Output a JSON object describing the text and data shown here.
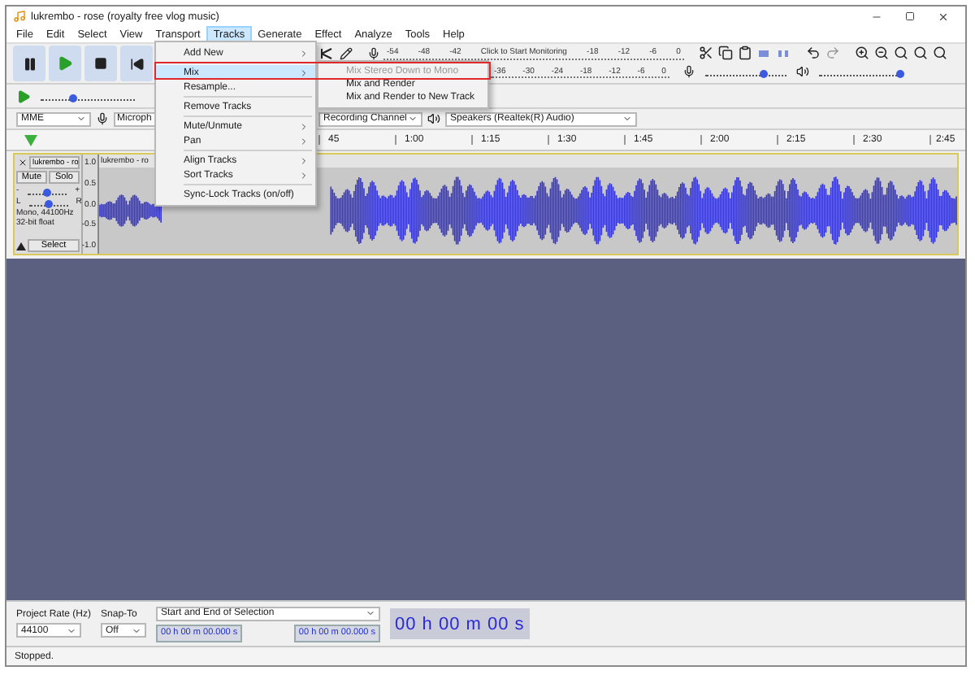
{
  "window": {
    "title": "lukrembo - rose (royalty free vlog music)"
  },
  "menu_bar": [
    {
      "label": "File",
      "selected": false
    },
    {
      "label": "Edit",
      "selected": false
    },
    {
      "label": "Select",
      "selected": false
    },
    {
      "label": "View",
      "selected": false
    },
    {
      "label": "Transport",
      "selected": false
    },
    {
      "label": "Tracks",
      "selected": true
    },
    {
      "label": "Generate",
      "selected": false
    },
    {
      "label": "Effect",
      "selected": false
    },
    {
      "label": "Analyze",
      "selected": false
    },
    {
      "label": "Tools",
      "selected": false
    },
    {
      "label": "Help",
      "selected": false
    }
  ],
  "tracks_menu": {
    "groups": [
      {
        "items": [
          {
            "label": "Add New",
            "submenu": true,
            "selected": false
          }
        ]
      },
      {
        "items": [
          {
            "label": "Mix",
            "submenu": true,
            "selected": true
          },
          {
            "label": "Resample...",
            "submenu": false,
            "selected": false
          }
        ]
      },
      {
        "items": [
          {
            "label": "Remove Tracks",
            "submenu": false,
            "selected": false
          }
        ]
      },
      {
        "items": [
          {
            "label": "Mute/Unmute",
            "submenu": true,
            "selected": false
          },
          {
            "label": "Pan",
            "submenu": true,
            "selected": false
          }
        ]
      },
      {
        "items": [
          {
            "label": "Align Tracks",
            "submenu": true,
            "selected": false
          },
          {
            "label": "Sort Tracks",
            "submenu": true,
            "selected": false
          }
        ]
      },
      {
        "items": [
          {
            "label": "Sync-Lock Tracks (on/off)",
            "submenu": false,
            "selected": false
          }
        ]
      }
    ]
  },
  "mix_submenu": [
    {
      "label": "Mix Stereo Down to Mono",
      "disabled": true
    },
    {
      "label": "Mix and Render",
      "disabled": false
    },
    {
      "label": "Mix and Render to New Track",
      "disabled": false
    }
  ],
  "meters": {
    "record_scale": [
      "-54",
      "-48",
      "-42"
    ],
    "record_prompt": "Click to Start Monitoring",
    "record_scale_end": [
      "-18",
      "-12",
      "-6",
      "0"
    ],
    "playback_scale": [
      "-36",
      "-30",
      "-24",
      "-18",
      "-12",
      "-6",
      "0"
    ]
  },
  "mixer": {
    "recording_volume": {
      "level": 0.72
    },
    "playback_volume": {
      "level": 1.0
    }
  },
  "play_at_speed": {
    "level": 0.35
  },
  "devices": {
    "host": "MME",
    "recording_device": "Microph",
    "recording_channels": "Recording Channel",
    "playback_device": "Speakers (Realtek(R) Audio)"
  },
  "ruler": {
    "labels": [
      "45",
      "1:00",
      "1:15",
      "1:30",
      "1:45",
      "2:00",
      "2:15",
      "2:30",
      "2:45"
    ]
  },
  "track": {
    "name": "lukrembo - ro",
    "clip_title": "lukrembo - ro",
    "mute": "Mute",
    "solo": "Solo",
    "gain": {
      "min": "-",
      "max": "+",
      "level": 0.5
    },
    "pan": {
      "left": "L",
      "right": "R",
      "level": 0.5
    },
    "info": [
      "Mono, 44100Hz",
      "32-bit float"
    ],
    "select": "Select",
    "scale": [
      "1.0",
      "0.5",
      "0.0",
      "-0.5",
      "-1.0"
    ]
  },
  "selection_toolbar": {
    "project_rate_label": "Project Rate (Hz)",
    "project_rate": "44100",
    "snap_label": "Snap-To",
    "snap": "Off",
    "selection_mode": "Start and End of Selection",
    "selection_start": "00 h 00 m 00.000 s",
    "selection_end": "00 h 00 m 00.000 s"
  },
  "time_display": "00 h 00 m 00 s",
  "status": "Stopped."
}
